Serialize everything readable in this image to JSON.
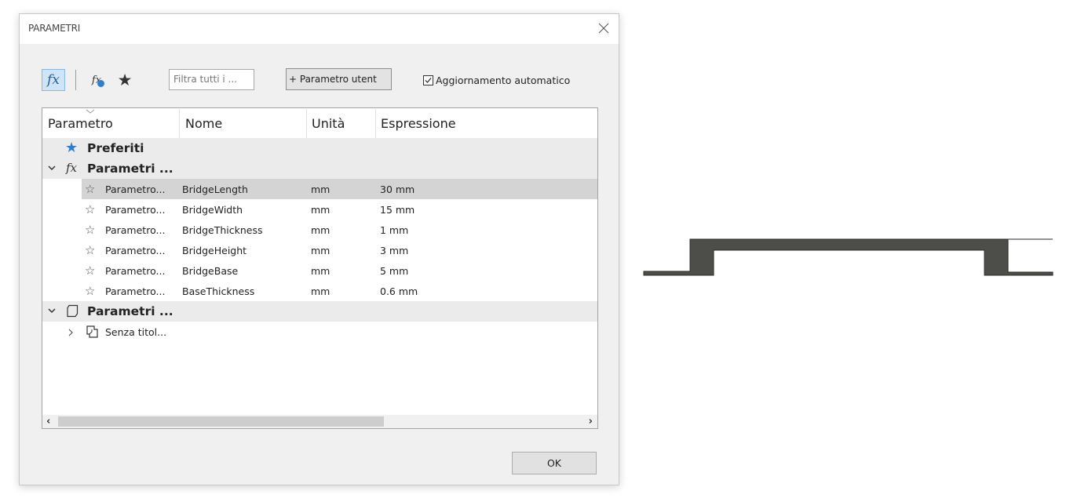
{
  "dialog": {
    "title": "PARAMETRI",
    "toolbar": {
      "fx_icon": "fx",
      "user_fx_icon": "fx",
      "filter_placeholder": "Filtra tutti i ...",
      "add_param_label": "+ Parametro utent",
      "auto_update_label": "Aggiornamento automatico",
      "auto_update_checked": true
    },
    "columns": [
      "Parametro",
      "Nome",
      "Unità",
      "Espressione"
    ],
    "groups": {
      "favorites": "Preferiti",
      "user_params": "Parametri ...",
      "model_params": "Parametri ..."
    },
    "rows": [
      {
        "param": "Parametro...",
        "name": "BridgeLength",
        "unit": "mm",
        "expr": "30 mm"
      },
      {
        "param": "Parametro...",
        "name": "BridgeWidth",
        "unit": "mm",
        "expr": "15 mm"
      },
      {
        "param": "Parametro...",
        "name": "BridgeThickness",
        "unit": "mm",
        "expr": "1 mm"
      },
      {
        "param": "Parametro...",
        "name": "BridgeHeight",
        "unit": "mm",
        "expr": "3 mm"
      },
      {
        "param": "Parametro...",
        "name": "BridgeBase",
        "unit": "mm",
        "expr": "5 mm"
      },
      {
        "param": "Parametro...",
        "name": "BaseThickness",
        "unit": "mm",
        "expr": "0.6 mm"
      }
    ],
    "model_item": "Senza titol...",
    "ok_label": "OK"
  },
  "colors": {
    "accent": "#2e7ecf",
    "fx_active_bg": "#cfe4f7",
    "drawing_fill": "#4d4d49"
  }
}
